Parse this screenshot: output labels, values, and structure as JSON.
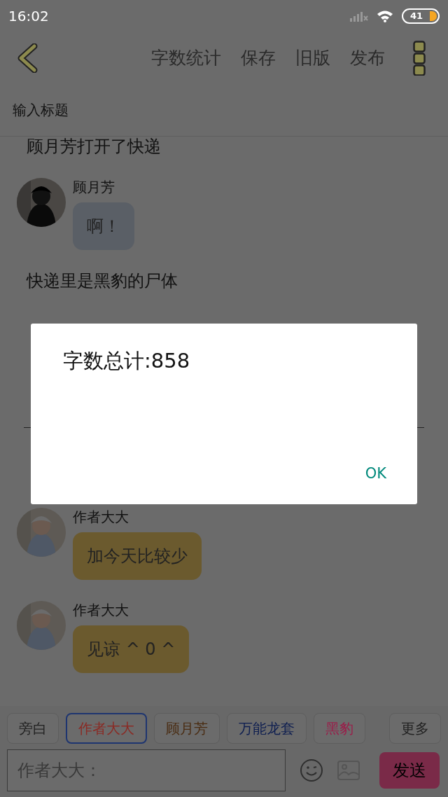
{
  "status_bar": {
    "time": "16:02",
    "battery": "41"
  },
  "toolbar": {
    "actions": [
      "字数统计",
      "保存",
      "旧版",
      "发布"
    ]
  },
  "title_field": {
    "placeholder": "输入标题"
  },
  "messages": [
    {
      "kind": "narration",
      "text": "顾月芳打开了快递"
    },
    {
      "kind": "chat",
      "name": "顾月芳",
      "text": "啊！",
      "color": "#5a5f66"
    },
    {
      "kind": "narration",
      "text": "快递里是黑豹的尸体"
    },
    {
      "kind": "divider"
    },
    {
      "kind": "chat",
      "name": "作者大大",
      "text": "加今天比较少",
      "color": "#6b5a2e"
    },
    {
      "kind": "chat",
      "name": "作者大大",
      "text": "见谅 ^ 0 ^",
      "color": "#6b5a2e"
    }
  ],
  "characters": [
    {
      "label": "旁白",
      "color": "#222222",
      "selected": false
    },
    {
      "label": "作者大大",
      "color": "#8a2a24",
      "selected": true
    },
    {
      "label": "顾月芳",
      "color": "#4a2c12",
      "selected": false
    },
    {
      "label": "万能龙套",
      "color": "#0e1e50",
      "selected": false
    },
    {
      "label": "黑豹",
      "color": "#9a1e4a",
      "selected": false
    }
  ],
  "more_button": "更多",
  "input": {
    "placeholder": "作者大大："
  },
  "send_button": "发送",
  "dialog": {
    "message": "字数总计:858",
    "button": "OK"
  }
}
